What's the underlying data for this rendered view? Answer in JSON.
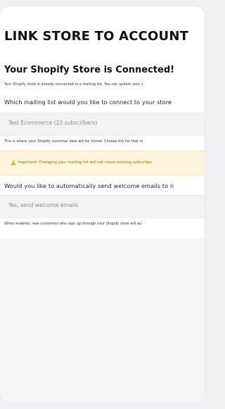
{
  "page": {
    "title": "LINK STORE TO ACCOUNT"
  },
  "connected": {
    "heading": "Your Shopify Store is Connected!",
    "description": "Your Shopify store is already connected to a mailing list. You can update your s"
  },
  "mailing_list": {
    "question": "Which mailing list would you like to connect to your store",
    "selected_value": "Test Ecommerce (22 subscribers)",
    "help": "This is where your Shopify customer data will be stored. Choose the list that m"
  },
  "warning": {
    "icon": "warning-triangle-icon",
    "text": "Important: Changing your mailing list will not move existing subscriber"
  },
  "welcome_emails": {
    "question": "Would you like to automatically send welcome emails to n",
    "selected_value": "Yes, send welcome emails",
    "help": "When enabled, new customers who sign up through your Shopify store will au"
  },
  "colors": {
    "warning_background": "#fdf5dc",
    "warning_text": "#8a6a10",
    "warning_icon": "#d9a21b"
  }
}
